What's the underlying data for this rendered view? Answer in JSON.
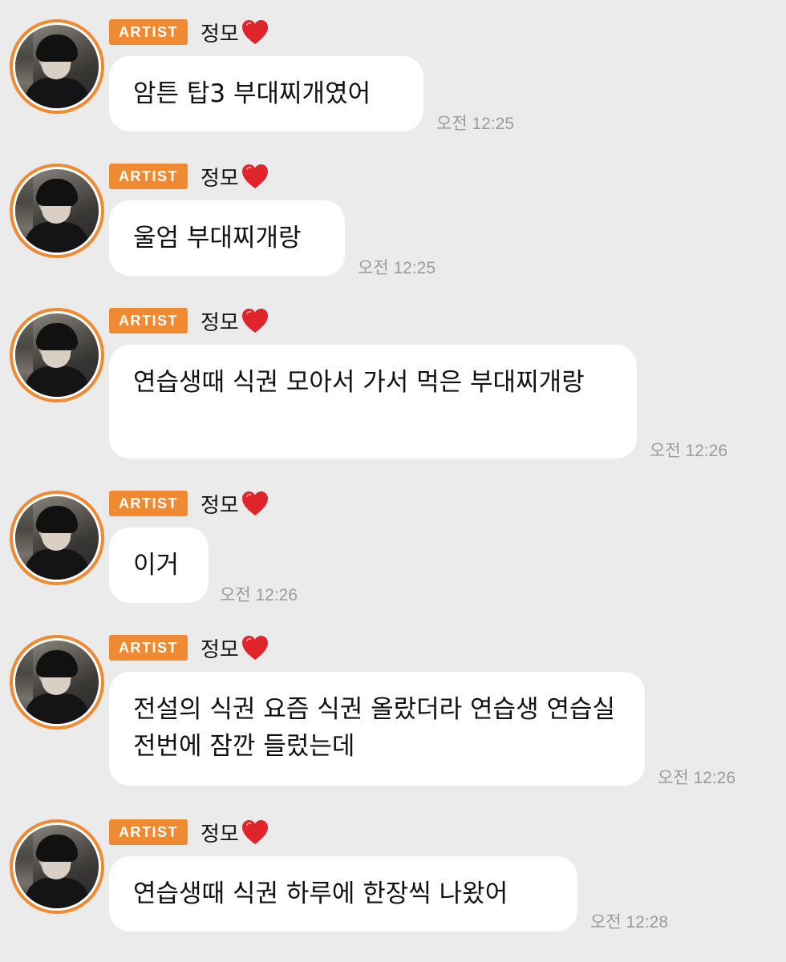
{
  "theme": {
    "accent": "#f08a32",
    "background": "#ebebeb",
    "bubble": "#ffffff"
  },
  "messages": [
    {
      "badge": "ARTIST",
      "sender": "정모",
      "icon": "heart-icon",
      "text": "암튼 탑3 부대찌개였어",
      "time": "오전 12:25"
    },
    {
      "badge": "ARTIST",
      "sender": "정모",
      "icon": "heart-icon",
      "text": "울엄 부대찌개랑",
      "time": "오전 12:25"
    },
    {
      "badge": "ARTIST",
      "sender": "정모",
      "icon": "heart-icon",
      "text": "연습생때 식권 모아서 가서 먹은 부대찌개랑",
      "time": "오전 12:26"
    },
    {
      "badge": "ARTIST",
      "sender": "정모",
      "icon": "heart-icon",
      "text": "이거",
      "time": "오전 12:26"
    },
    {
      "badge": "ARTIST",
      "sender": "정모",
      "icon": "heart-icon",
      "text": "전설의 식권 요즘 식권 올랐더라 연습생 연습실 전번에 잠깐 들렀는데",
      "time": "오전 12:26"
    },
    {
      "badge": "ARTIST",
      "sender": "정모",
      "icon": "heart-icon",
      "text": "연습생때 식권 하루에 한장씩 나왔어",
      "time": "오전 12:28"
    }
  ]
}
